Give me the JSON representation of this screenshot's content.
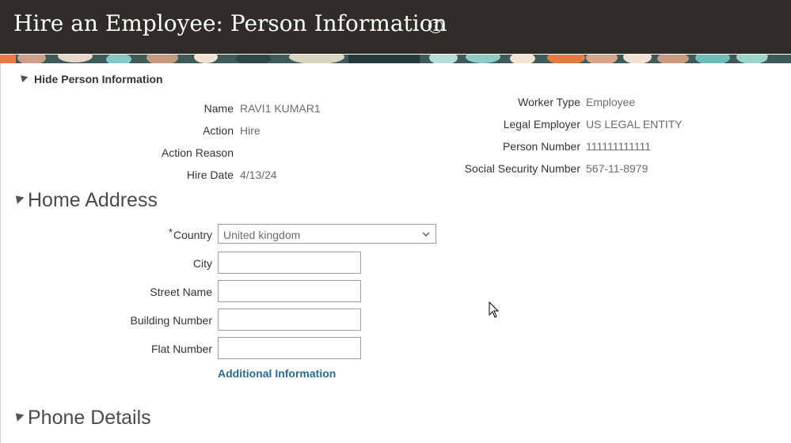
{
  "header": {
    "title": "Hire an Employee: Person Information",
    "help_icon": "question-circle-icon"
  },
  "person_info": {
    "toggle_label": "Hide Person Information",
    "left_fields": [
      {
        "label": "Name",
        "value": "RAVI1 KUMAR1"
      },
      {
        "label": "Action",
        "value": "Hire"
      },
      {
        "label": "Action Reason",
        "value": ""
      },
      {
        "label": "Hire Date",
        "value": "4/13/24"
      }
    ],
    "right_fields": [
      {
        "label": "Worker Type",
        "value": "Employee"
      },
      {
        "label": "Legal Employer",
        "value": "US LEGAL ENTITY"
      },
      {
        "label": "Person Number",
        "value": "111111111111"
      },
      {
        "label": "Social Security Number",
        "value": "567-11-8979"
      }
    ]
  },
  "home_address": {
    "title": "Home Address",
    "country": {
      "required_mark": "*",
      "label": "Country",
      "value": "United kingdom"
    },
    "fields": [
      {
        "label": "City",
        "value": ""
      },
      {
        "label": "Street Name",
        "value": ""
      },
      {
        "label": "Building Number",
        "value": ""
      },
      {
        "label": "Flat Number",
        "value": ""
      }
    ],
    "additional_info_link": "Additional Information"
  },
  "phone_details": {
    "title": "Phone Details"
  },
  "colors": {
    "header_bg": "#302d29",
    "link": "#2a6a8e",
    "value_text": "#6b6b6b"
  }
}
